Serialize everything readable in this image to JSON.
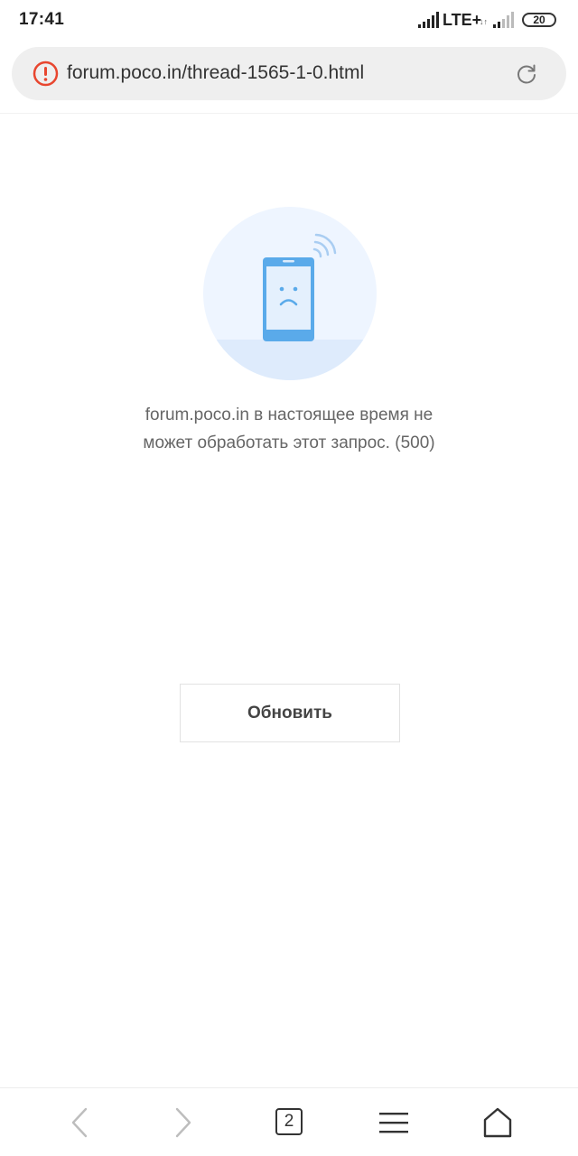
{
  "status_bar": {
    "time": "17:41",
    "network": "LTE+",
    "battery": "20"
  },
  "address_bar": {
    "url": "forum.poco.in/thread-1565-1-0.html"
  },
  "error": {
    "line1": "forum.poco.in в настоящее время не",
    "line2": "может обработать этот запрос. (500)"
  },
  "refresh_button": {
    "label": "Обновить"
  },
  "bottom_nav": {
    "tab_count": "2"
  },
  "colors": {
    "warning": "#e8462f",
    "illustration_bg": "#eef5ff",
    "phone_blue": "#5aaaea"
  },
  "icons": [
    "warning-icon",
    "reload-icon",
    "back-icon",
    "forward-icon",
    "tabs-icon",
    "menu-icon",
    "home-icon"
  ]
}
